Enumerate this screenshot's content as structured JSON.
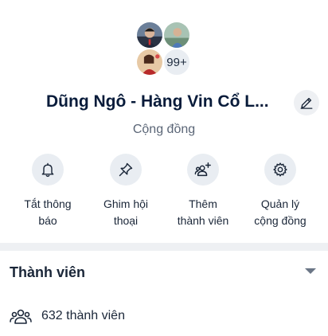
{
  "group": {
    "avatar_count": "99+",
    "title": "Dũng Ngô - Hàng Vin Cổ L...",
    "type": "Cộng đồng"
  },
  "actions": [
    {
      "label_line1": "Tắt thông",
      "label_line2": "báo",
      "icon": "bell-icon"
    },
    {
      "label_line1": "Ghim hội",
      "label_line2": "thoại",
      "icon": "pin-icon"
    },
    {
      "label_line1": "Thêm",
      "label_line2": "thành viên",
      "icon": "add-member-icon"
    },
    {
      "label_line1": "Quản lý",
      "label_line2": "cộng đồng",
      "icon": "gear-icon"
    }
  ],
  "members": {
    "section_title": "Thành viên",
    "count_text": "632 thành viên"
  }
}
